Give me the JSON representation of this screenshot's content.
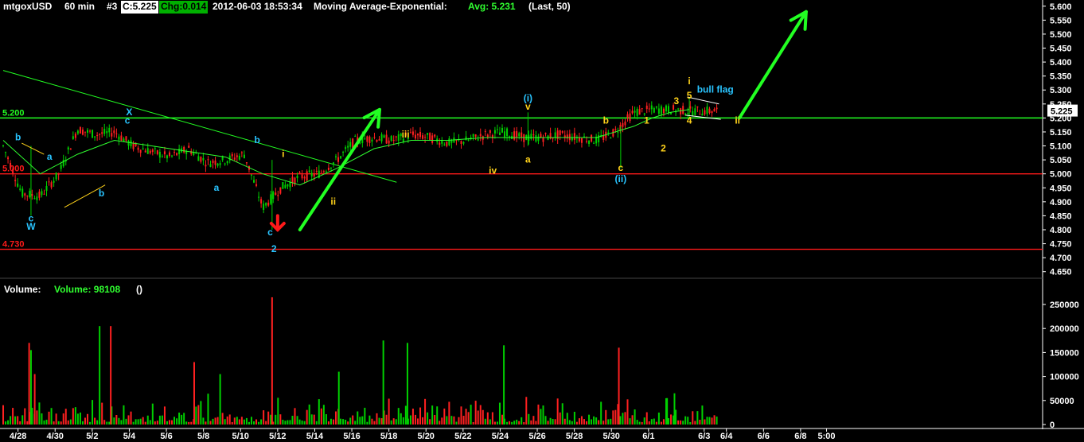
{
  "header": {
    "symbol": "mtgoxUSD",
    "interval": "60 min",
    "id": "#3",
    "close": "C:5.225",
    "change": "Chg:0.014",
    "datetime": "2012-06-03 18:53:34",
    "study": "Moving Average-Exponential:",
    "avg": "Avg: 5.231",
    "params": "(Last, 50)"
  },
  "volume_header": {
    "label": "Volume:",
    "value": "Volume: 98108",
    "paren": "()"
  },
  "colors": {
    "background": "#000000",
    "up_bar": "#00d000",
    "down_bar": "#ff2020",
    "ema": "#30ff30",
    "level_green": "#22ff22",
    "level_red": "#ff1a1a",
    "wave_cyan": "#29c4ff",
    "wave_yellow": "#ffd21a",
    "arrow_green": "#22ff22",
    "arrow_red": "#ff1a1a",
    "axis_text": "#ffffff"
  },
  "chart_data": [
    {
      "type": "candlestick",
      "title": "mtgoxUSD 60 min",
      "x_tick_labels": [
        "4/28",
        "4/30",
        "5/2",
        "5/4",
        "5/6",
        "5/8",
        "5/10",
        "5/12",
        "5/14",
        "5/16",
        "5/18",
        "5/20",
        "5/22",
        "5/24",
        "5/26",
        "5/28",
        "5/30",
        "6/1",
        "6/3",
        "6/4",
        "6/6",
        "6/8",
        "5:00"
      ],
      "y_tick_labels": [
        "5.600",
        "5.550",
        "5.500",
        "5.450",
        "5.400",
        "5.350",
        "5.300",
        "5.250",
        "5.200",
        "5.150",
        "5.100",
        "5.050",
        "5.000",
        "4.950",
        "4.900",
        "4.850",
        "4.800",
        "4.750",
        "4.700",
        "4.650"
      ],
      "ylim": [
        4.62,
        5.61
      ],
      "last_price": "5.225",
      "series": [
        {
          "name": "Price",
          "days": [
            0,
            1,
            2,
            3,
            4,
            5,
            6,
            7,
            8,
            9,
            10,
            11,
            12,
            13,
            14,
            15,
            16,
            17,
            18,
            19,
            20,
            21,
            22,
            23,
            24,
            25,
            26,
            27,
            28,
            29,
            30,
            31,
            32,
            33,
            34,
            35,
            36,
            37
          ],
          "values": [
            5.1,
            4.93,
            4.92,
            5.0,
            5.16,
            5.14,
            5.15,
            5.1,
            5.08,
            5.06,
            5.09,
            5.04,
            5.05,
            5.07,
            4.88,
            4.95,
            4.99,
            5.0,
            5.05,
            5.12,
            5.13,
            5.12,
            5.14,
            5.13,
            5.11,
            5.12,
            5.14,
            5.15,
            5.13,
            5.13,
            5.14,
            5.13,
            5.12,
            5.15,
            5.22,
            5.23,
            5.23,
            5.225
          ]
        }
      ],
      "ema": {
        "name": "Moving Average-Exponential",
        "period": 50,
        "days": [
          0,
          2,
          4,
          6,
          8,
          10,
          12,
          14,
          16,
          18,
          20,
          22,
          24,
          26,
          28,
          30,
          32,
          34,
          35,
          36,
          37
        ],
        "values": [
          5.12,
          5.0,
          5.07,
          5.12,
          5.1,
          5.08,
          5.06,
          5.0,
          4.96,
          5.02,
          5.09,
          5.12,
          5.12,
          5.13,
          5.13,
          5.13,
          5.13,
          5.17,
          5.2,
          5.22,
          5.23
        ]
      },
      "horizontal_levels": [
        {
          "value": 5.2,
          "label": "5.200",
          "color": "#22ff22"
        },
        {
          "value": 5.0,
          "label": "5.000",
          "color": "#ff1a1a"
        },
        {
          "value": 4.73,
          "label": "4.730",
          "color": "#ff1a1a"
        }
      ],
      "trendline": {
        "from": {
          "day": 0,
          "price": 5.37
        },
        "to": {
          "day": 21,
          "price": 4.97
        }
      },
      "annotations": [
        {
          "text": "b",
          "day": 0.8,
          "price": 5.12,
          "color": "#29c4ff"
        },
        {
          "text": "a",
          "day": 2.5,
          "price": 5.05,
          "color": "#29c4ff"
        },
        {
          "text": "c",
          "day": 1.5,
          "price": 4.83,
          "color": "#29c4ff"
        },
        {
          "text": "W",
          "day": 1.5,
          "price": 4.8,
          "color": "#29c4ff"
        },
        {
          "text": "b",
          "day": 5.3,
          "price": 4.92,
          "color": "#29c4ff"
        },
        {
          "text": "X",
          "day": 6.8,
          "price": 5.21,
          "color": "#29c4ff"
        },
        {
          "text": "c",
          "day": 6.7,
          "price": 5.18,
          "color": "#29c4ff"
        },
        {
          "text": "a",
          "day": 11.5,
          "price": 4.94,
          "color": "#29c4ff"
        },
        {
          "text": "b",
          "day": 13.7,
          "price": 5.11,
          "color": "#29c4ff"
        },
        {
          "text": "c",
          "day": 14.4,
          "price": 4.78,
          "color": "#29c4ff"
        },
        {
          "text": "2",
          "day": 14.6,
          "price": 4.72,
          "color": "#29c4ff"
        },
        {
          "text": "i",
          "day": 15.1,
          "price": 5.06,
          "color": "#ffd21a"
        },
        {
          "text": "ii",
          "day": 17.8,
          "price": 4.89,
          "color": "#ffd21a"
        },
        {
          "text": "iii",
          "day": 21.7,
          "price": 5.13,
          "color": "#ffd21a"
        },
        {
          "text": "iv",
          "day": 26.4,
          "price": 5.0,
          "color": "#ffd21a"
        },
        {
          "text": "(i)",
          "day": 28.3,
          "price": 5.26,
          "color": "#29c4ff"
        },
        {
          "text": "v",
          "day": 28.3,
          "price": 5.23,
          "color": "#ffd21a"
        },
        {
          "text": "a",
          "day": 28.3,
          "price": 5.04,
          "color": "#ffd21a"
        },
        {
          "text": "b",
          "day": 32.5,
          "price": 5.18,
          "color": "#ffd21a"
        },
        {
          "text": "c",
          "day": 33.3,
          "price": 5.01,
          "color": "#ffd21a"
        },
        {
          "text": "(ii)",
          "day": 33.3,
          "price": 4.97,
          "color": "#29c4ff"
        },
        {
          "text": "1",
          "day": 34.7,
          "price": 5.18,
          "color": "#ffd21a"
        },
        {
          "text": "2",
          "day": 35.6,
          "price": 5.08,
          "color": "#ffd21a"
        },
        {
          "text": "3",
          "day": 36.3,
          "price": 5.25,
          "color": "#ffd21a"
        },
        {
          "text": "i",
          "day": 37.0,
          "price": 5.32,
          "color": "#ffd21a"
        },
        {
          "text": "5",
          "day": 37.0,
          "price": 5.27,
          "color": "#ffd21a"
        },
        {
          "text": "4",
          "day": 37.0,
          "price": 5.18,
          "color": "#ffd21a"
        },
        {
          "text": "bull flag",
          "day": 38.4,
          "price": 5.29,
          "color": "#29c4ff"
        },
        {
          "text": "ii",
          "day": 39.6,
          "price": 5.18,
          "color": "#ffd21a"
        }
      ],
      "arrows": [
        {
          "color": "#22ff22",
          "from": {
            "day": 16.0,
            "price": 4.8
          },
          "to": {
            "day": 20.3,
            "price": 5.23
          }
        },
        {
          "color": "#22ff22",
          "from": {
            "day": 39.7,
            "price": 5.2
          },
          "to": {
            "day": 43.3,
            "price": 5.58
          }
        },
        {
          "color": "#ff1a1a",
          "from": {
            "day": 14.8,
            "price": 4.85
          },
          "to": {
            "day": 14.8,
            "price": 4.8
          }
        }
      ]
    },
    {
      "type": "bar",
      "title": "Volume",
      "y_tick_labels": [
        "250000",
        "200000",
        "150000",
        "100000",
        "50000",
        "0"
      ],
      "ylim": [
        0,
        280000
      ],
      "series": [
        {
          "name": "Volume",
          "spikes": [
            {
              "day": 1.4,
              "value": 170000,
              "up": false
            },
            {
              "day": 1.5,
              "value": 155000,
              "up": true
            },
            {
              "day": 1.7,
              "value": 105000,
              "up": false
            },
            {
              "day": 5.2,
              "value": 205000,
              "up": true
            },
            {
              "day": 5.8,
              "value": 205000,
              "up": false
            },
            {
              "day": 10.3,
              "value": 130000,
              "up": false
            },
            {
              "day": 11.7,
              "value": 105000,
              "up": true
            },
            {
              "day": 14.5,
              "value": 265000,
              "up": false
            },
            {
              "day": 18.1,
              "value": 110000,
              "up": true
            },
            {
              "day": 20.5,
              "value": 175000,
              "up": true
            },
            {
              "day": 21.8,
              "value": 170000,
              "up": true
            },
            {
              "day": 27.0,
              "value": 165000,
              "up": true
            },
            {
              "day": 33.2,
              "value": 160000,
              "up": false
            },
            {
              "day": 35.8,
              "value": 55000,
              "up": true
            },
            {
              "day": 36.2,
              "value": 65000,
              "up": true
            }
          ],
          "last_value": 98108
        }
      ]
    }
  ]
}
